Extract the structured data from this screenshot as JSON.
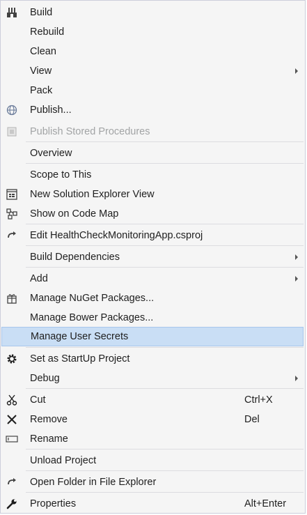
{
  "menu": {
    "items": [
      {
        "label": "Build",
        "icon": "build-icon"
      },
      {
        "label": "Rebuild"
      },
      {
        "label": "Clean"
      },
      {
        "label": "View",
        "submenu": true
      },
      {
        "label": "Pack"
      },
      {
        "label": "Publish...",
        "icon": "globe-icon"
      },
      {
        "label": "Publish Stored Procedures",
        "icon": "database-icon",
        "disabled": true
      },
      {
        "label": "Overview"
      },
      {
        "label": "Scope to This"
      },
      {
        "label": "New Solution Explorer View",
        "icon": "solution-explorer-icon"
      },
      {
        "label": "Show on Code Map",
        "icon": "code-map-icon"
      },
      {
        "label": "Edit HealthCheckMonitoringApp.csproj",
        "icon": "edit-arrow-icon"
      },
      {
        "label": "Build Dependencies",
        "submenu": true
      },
      {
        "label": "Add",
        "submenu": true
      },
      {
        "label": "Manage NuGet Packages...",
        "icon": "nuget-icon"
      },
      {
        "label": "Manage Bower Packages..."
      },
      {
        "label": "Manage User Secrets",
        "highlighted": true
      },
      {
        "label": "Set as StartUp Project",
        "icon": "gear-icon"
      },
      {
        "label": "Debug",
        "submenu": true
      },
      {
        "label": "Cut",
        "icon": "scissors-icon",
        "shortcut": "Ctrl+X"
      },
      {
        "label": "Remove",
        "icon": "close-icon",
        "shortcut": "Del"
      },
      {
        "label": "Rename",
        "icon": "rename-icon"
      },
      {
        "label": "Unload Project"
      },
      {
        "label": "Open Folder in File Explorer",
        "icon": "open-folder-arrow-icon"
      },
      {
        "label": "Properties",
        "icon": "wrench-icon",
        "shortcut": "Alt+Enter"
      }
    ]
  },
  "colors": {
    "background": "#f5f5f5",
    "highlight": "#c9def5",
    "highlight_border": "#a7c6ec",
    "text": "#1e1e1e",
    "disabled_text": "#a2a4a5",
    "separator": "#dcdce0"
  }
}
